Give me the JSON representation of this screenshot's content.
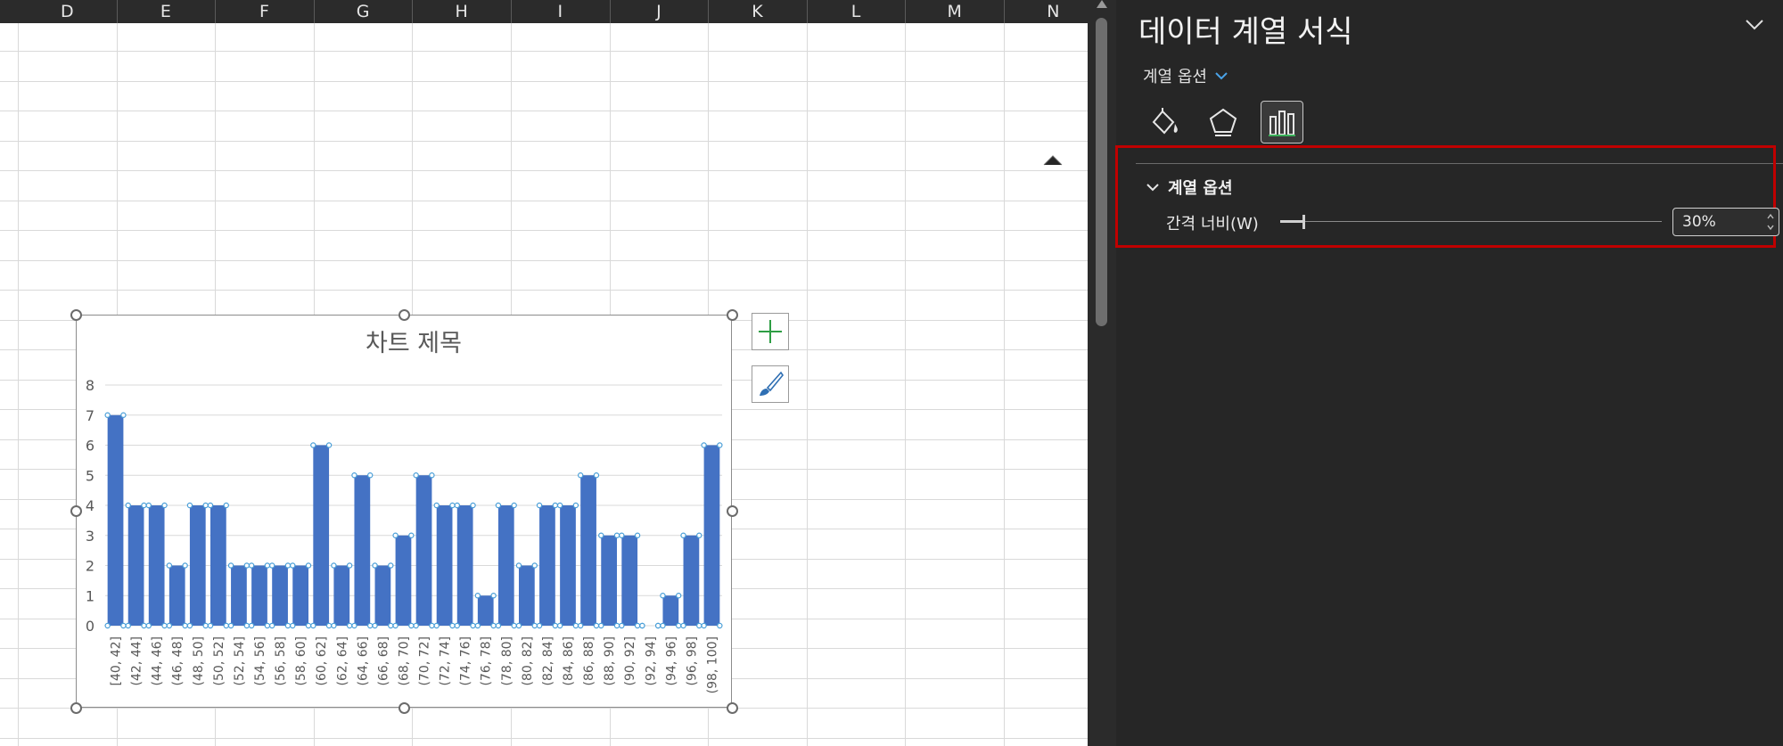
{
  "sheet": {
    "columns": [
      "D",
      "E",
      "F",
      "G",
      "H",
      "I",
      "J",
      "K",
      "L",
      "M",
      "N"
    ]
  },
  "chart_data": {
    "type": "bar",
    "title": "차트 제목",
    "categories": [
      "[40, 42]",
      "(42, 44]",
      "(44, 46]",
      "(46, 48]",
      "(48, 50]",
      "(50, 52]",
      "(52, 54]",
      "(54, 56]",
      "(56, 58]",
      "(58, 60]",
      "(60, 62]",
      "(62, 64]",
      "(64, 66]",
      "(66, 68]",
      "(68, 70]",
      "(70, 72]",
      "(72, 74]",
      "(74, 76]",
      "(76, 78]",
      "(78, 80]",
      "(80, 82]",
      "(82, 84]",
      "(84, 86]",
      "(86, 88]",
      "(88, 90]",
      "(90, 92]",
      "(92, 94]",
      "(94, 96]",
      "(96, 98]",
      "(98, 100]"
    ],
    "values": [
      7,
      4,
      4,
      2,
      4,
      4,
      2,
      2,
      2,
      2,
      6,
      2,
      5,
      2,
      3,
      5,
      4,
      4,
      1,
      4,
      2,
      4,
      4,
      5,
      3,
      3,
      0,
      1,
      3,
      6
    ],
    "ylim": [
      0,
      8
    ],
    "yticks": [
      0,
      1,
      2,
      3,
      4,
      5,
      6,
      7,
      8
    ],
    "color": "#4472c4",
    "grid": true,
    "gap_width_percent": 30
  },
  "chart_buttons": {
    "add_element_icon": "plus-icon",
    "style_icon": "brush-icon"
  },
  "pane": {
    "title": "데이터 계열 서식",
    "options_dropdown": "계열 옵션",
    "tabs": [
      {
        "icon": "fill-line-icon",
        "active": false
      },
      {
        "icon": "effects-pentagon-icon",
        "active": false
      },
      {
        "icon": "series-options-icon",
        "active": true
      }
    ],
    "section_title": "계열 옵션",
    "gap_width_label": "간격 너비(W)",
    "gap_width_value": "30%",
    "gap_width_fraction": 0.06,
    "accent_color": "#c00000"
  }
}
